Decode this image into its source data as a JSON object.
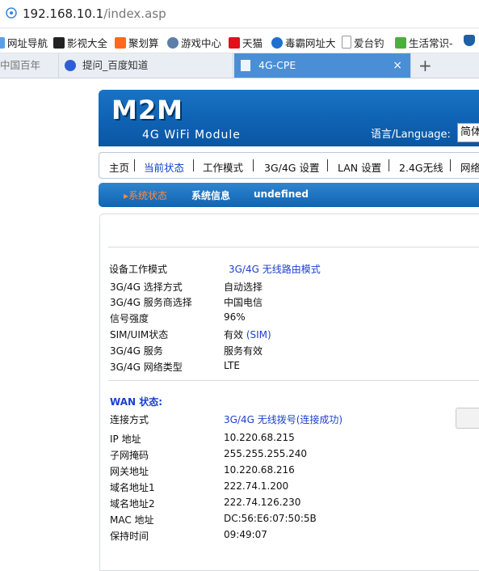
{
  "browser": {
    "url_host": "192.168.10.1",
    "url_path": "/index.asp",
    "bookmarks": [
      "网址导航",
      "影视大全",
      "聚划算",
      "游戏中心",
      "天猫",
      "毒霸网址大",
      "爱台钓",
      "生活常识-"
    ],
    "tabs": [
      "中国百年",
      "提问_百度知道",
      "4G-CPE"
    ],
    "tab_close": "×",
    "new_tab": "+"
  },
  "header": {
    "logo": "M2M",
    "subtitle": "4G WiFi Module",
    "language_label": "语言/Language:",
    "language_value": "简体"
  },
  "nav": {
    "items": [
      "主页",
      "当前状态",
      "工作模式",
      "3G/4G 设置",
      "LAN 设置",
      "2.4G无线",
      "网络"
    ]
  },
  "subnav": {
    "items": [
      "系统状态",
      "系统信息",
      "undefined"
    ],
    "active_marker": "▸"
  },
  "status": {
    "device_mode_label": "设备工作模式",
    "device_mode_value": "3G/4G 无线路由模式",
    "rows": [
      {
        "label": "3G/4G 选择方式",
        "value": "自动选择"
      },
      {
        "label": "3G/4G 服务商选择",
        "value": "中国电信"
      },
      {
        "label": "信号强度",
        "value": "96%"
      },
      {
        "label": "SIM/UIM状态",
        "value": "有效",
        "extra": "(SIM)"
      },
      {
        "label": "3G/4G 服务",
        "value": "服务有效"
      },
      {
        "label": "3G/4G 网络类型",
        "value": "LTE"
      }
    ]
  },
  "wan": {
    "title": "WAN 状态:",
    "conn_label": "连接方式",
    "conn_value": "3G/4G 无线拨号(连接成功)",
    "rows": [
      {
        "label": "IP 地址",
        "value": "10.220.68.215"
      },
      {
        "label": "子网掩码",
        "value": "255.255.255.240"
      },
      {
        "label": "网关地址",
        "value": "10.220.68.216"
      },
      {
        "label": "域名地址1",
        "value": "222.74.1.200"
      },
      {
        "label": "域名地址2",
        "value": "222.74.126.230"
      },
      {
        "label": "MAC 地址",
        "value": "DC:56:E6:07:50:5B"
      },
      {
        "label": "保持时间",
        "value": "09:49:07"
      }
    ]
  },
  "colors": {
    "header_blue": "#0f62b3",
    "link_blue": "#1e3fcc",
    "active_orange": "#ff8a3c",
    "tab_active": "#4a8fd6"
  }
}
